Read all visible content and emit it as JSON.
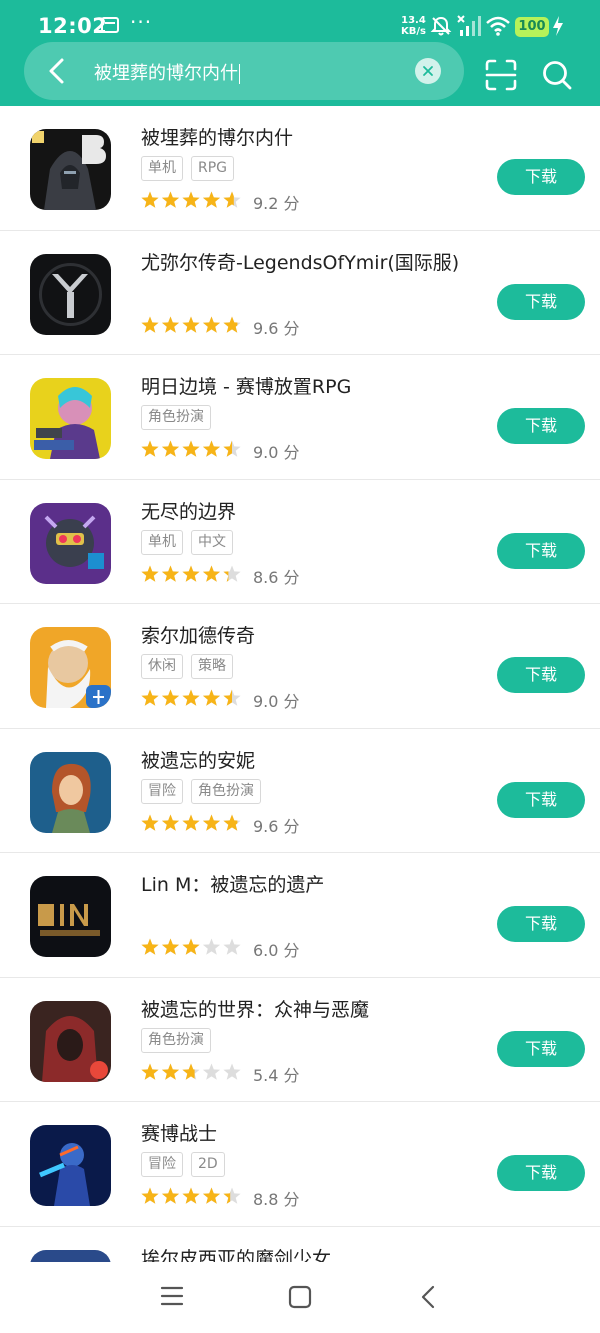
{
  "status_bar": {
    "time": "12:02",
    "dots": "···",
    "net_speed_value": "13.4",
    "net_speed_unit": "KB/s",
    "battery": "100"
  },
  "search": {
    "query": "被埋葬的博尔内什"
  },
  "apps": [
    {
      "name": "被埋葬的博尔内什",
      "tags": [
        "单机",
        "RPG"
      ],
      "rating": 4.6,
      "score": "9.2 分",
      "download": "下载"
    },
    {
      "name": "尤弥尔传奇-LegendsOfYmir(国际服)",
      "tags": [],
      "rating": 4.8,
      "score": "9.6 分",
      "download": "下载"
    },
    {
      "name": "明日边境 - 赛博放置RPG",
      "tags": [
        "角色扮演"
      ],
      "rating": 4.5,
      "score": "9.0 分",
      "download": "下载"
    },
    {
      "name": "无尽的边界",
      "tags": [
        "单机",
        "中文"
      ],
      "rating": 4.3,
      "score": "8.6 分",
      "download": "下载"
    },
    {
      "name": "索尔加德传奇",
      "tags": [
        "休闲",
        "策略"
      ],
      "rating": 4.5,
      "score": "9.0 分",
      "download": "下载"
    },
    {
      "name": "被遗忘的安妮",
      "tags": [
        "冒险",
        "角色扮演"
      ],
      "rating": 4.8,
      "score": "9.6 分",
      "download": "下载"
    },
    {
      "name": "Lin M：被遗忘的遗产",
      "tags": [],
      "rating": 3.0,
      "score": "6.0 分",
      "download": "下载"
    },
    {
      "name": "被遗忘的世界：众神与恶魔",
      "tags": [
        "角色扮演"
      ],
      "rating": 2.7,
      "score": "5.4 分",
      "download": "下载"
    },
    {
      "name": "赛博战士",
      "tags": [
        "冒险",
        "2D"
      ],
      "rating": 4.4,
      "score": "8.8 分",
      "download": "下载"
    },
    {
      "name": "埃尔皮西亚的魔剑少女",
      "tags": [],
      "rating": 0,
      "score": "",
      "download": ""
    }
  ],
  "icons": {
    "back": "back-arrow-icon",
    "clear": "clear-icon",
    "scan": "scan-icon",
    "search": "search-icon",
    "star": "star-icon",
    "nav_menu": "menu-icon",
    "nav_home": "home-icon",
    "nav_back": "back-icon"
  },
  "colors": {
    "accent": "#1dbb9b",
    "star": "#f7b417",
    "star_empty": "#dddddd",
    "battery": "#b7f25a"
  }
}
